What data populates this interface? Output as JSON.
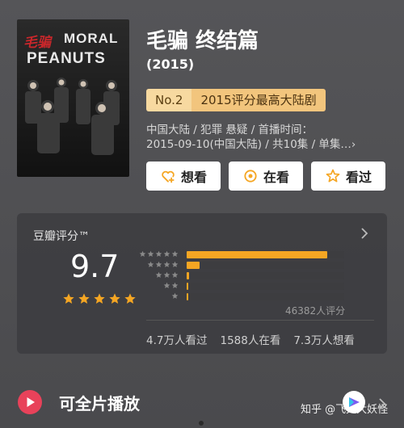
{
  "poster": {
    "title_cn": "毛骗",
    "title_en_line1": "MORAL",
    "title_en_line2": "PEANUTS"
  },
  "movie": {
    "title": "毛骗 终结篇",
    "year": "(2015)",
    "rank_no": "No.2",
    "rank_text": "2015评分最高大陆剧",
    "meta_line1": "中国大陆 / 犯罪 悬疑 / 首播时间：",
    "meta_line2": "2015-09-10(中国大陆) / 共10集 / 单集…›"
  },
  "actions": [
    {
      "label": "想看",
      "icon": "heart-plus-icon"
    },
    {
      "label": "在看",
      "icon": "watching-icon"
    },
    {
      "label": "看过",
      "icon": "star-outline-icon"
    }
  ],
  "rating": {
    "source_label": "豆瓣评分™",
    "score": "9.7",
    "stars": 5,
    "votes_text": "46382人评分",
    "distribution": [
      {
        "stars": 5,
        "fraction": 0.89
      },
      {
        "stars": 4,
        "fraction": 0.08
      },
      {
        "stars": 3,
        "fraction": 0.016
      },
      {
        "stars": 2,
        "fraction": 0.005
      },
      {
        "stars": 1,
        "fraction": 0.005
      }
    ],
    "stats": [
      "4.7万人看过",
      "1588人在看",
      "7.3万人想看"
    ]
  },
  "play": {
    "label": "可全片播放"
  },
  "watermark": {
    "text": "知乎 @飞天大妖怪"
  },
  "colors": {
    "accent": "#f5a623",
    "rank_light": "#f7d9a0",
    "rank_dark": "#f2c57d",
    "play_red": "#e8425a"
  }
}
